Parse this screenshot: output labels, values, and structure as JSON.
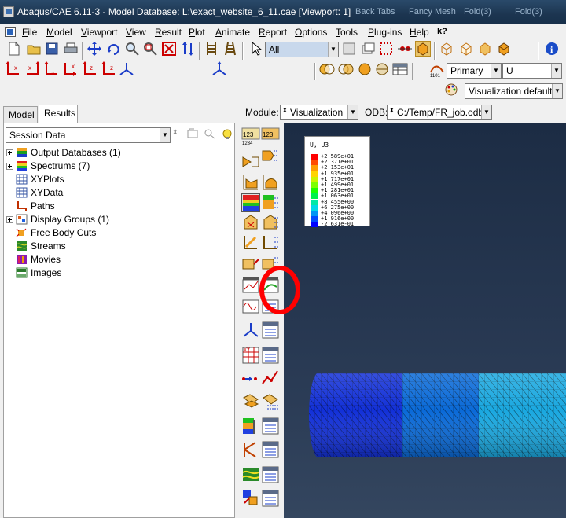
{
  "window": {
    "title": "Abaqus/CAE 6.11-3 - Model Database: L:\\exact_website_6_11.cae [Viewport: 1]",
    "background_tabs": [
      "Back Tabs",
      "Fancy Mesh",
      "Fold(3)",
      "Fold(3)"
    ]
  },
  "menu": {
    "items": [
      "File",
      "Model",
      "Viewport",
      "View",
      "Result",
      "Plot",
      "Animate",
      "Report",
      "Options",
      "Tools",
      "Plug-ins",
      "Help"
    ],
    "whats_this": "k?"
  },
  "toolbar": {
    "selection_filter": "All",
    "numbered_tools": [
      "1",
      "2",
      "3",
      "4"
    ],
    "primary_combo": "Primary",
    "variable_combo": "U",
    "visualization_defaults": "Visualization defaults",
    "info_icon": "i"
  },
  "left_panel": {
    "tabs": [
      "Model",
      "Results"
    ],
    "active_tab": "Results",
    "session_combo": "Session Data",
    "tree": [
      {
        "label": "Output Databases (1)",
        "expandable": true,
        "icon": "database-icon"
      },
      {
        "label": "Spectrums (7)",
        "expandable": true,
        "icon": "spectrum-icon"
      },
      {
        "label": "XYPlots",
        "expandable": false,
        "icon": "xyplot-icon"
      },
      {
        "label": "XYData",
        "expandable": false,
        "icon": "xydata-icon"
      },
      {
        "label": "Paths",
        "expandable": false,
        "icon": "path-icon"
      },
      {
        "label": "Display Groups (1)",
        "expandable": true,
        "icon": "display-group-icon"
      },
      {
        "label": "Free Body Cuts",
        "expandable": false,
        "icon": "free-body-cut-icon"
      },
      {
        "label": "Streams",
        "expandable": false,
        "icon": "stream-icon"
      },
      {
        "label": "Movies",
        "expandable": false,
        "icon": "movie-icon"
      },
      {
        "label": "Images",
        "expandable": false,
        "icon": "image-icon"
      }
    ]
  },
  "module_row": {
    "module_label": "Module:",
    "module_value": "Visualization",
    "odb_label": "ODB:",
    "odb_value": "C:/Temp/FR_job.odb"
  },
  "legend": {
    "title": "U, U3",
    "entries": [
      {
        "value": "+2.589e+01",
        "color": "#ff0000"
      },
      {
        "value": "+2.371e+01",
        "color": "#ff4a00"
      },
      {
        "value": "+2.153e+01",
        "color": "#ff9c00"
      },
      {
        "value": "+1.935e+01",
        "color": "#ffd400"
      },
      {
        "value": "+1.717e+01",
        "color": "#ccf400"
      },
      {
        "value": "+1.499e+01",
        "color": "#7cff00"
      },
      {
        "value": "+1.281e+01",
        "color": "#1dff00"
      },
      {
        "value": "+1.063e+01",
        "color": "#00f24a"
      },
      {
        "value": "+8.455e+00",
        "color": "#00e8a6"
      },
      {
        "value": "+6.275e+00",
        "color": "#00d8e8"
      },
      {
        "value": "+4.096e+00",
        "color": "#0096f4"
      },
      {
        "value": "+1.916e+00",
        "color": "#004cff"
      },
      {
        "value": "-2.631e-01",
        "color": "#0000ff"
      }
    ]
  },
  "colors": {
    "viewport_bg": "#1c2c44",
    "highlight_circle": "#ff0000",
    "mesh_dark": "#1230d8",
    "mesh_mid": "#0a6ad8",
    "mesh_light": "#1aa8e0"
  }
}
